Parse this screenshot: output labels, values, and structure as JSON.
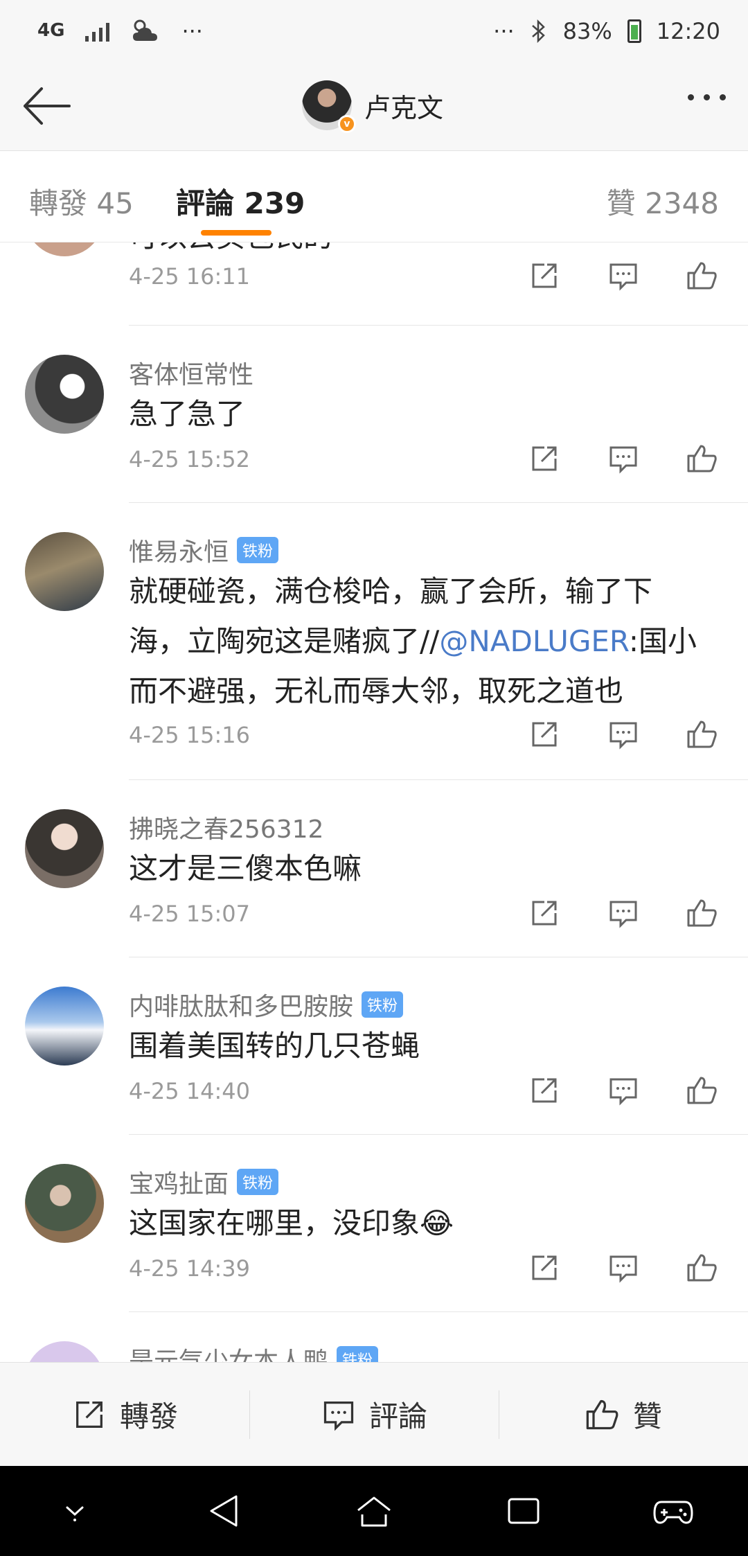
{
  "status_bar": {
    "network": "4G",
    "more_dots": "···",
    "right_dots": "···",
    "battery": "83%",
    "time": "12:20"
  },
  "nav": {
    "title": "卢克文"
  },
  "tabs": [
    {
      "label": "轉發 45"
    },
    {
      "label": "評論 239"
    },
    {
      "label": "贊 2348"
    }
  ],
  "comments": [
    {
      "name": "",
      "text": "可以去买包氏的",
      "time": "4-25 16:11"
    },
    {
      "name": "客体恒常性",
      "text": "急了急了",
      "time": "4-25 15:52"
    },
    {
      "name": "惟易永恒",
      "badge": "铁粉",
      "text_before": "就硬碰瓷，满仓梭哈，赢了会所，输了下海，立陶宛这是赌疯了//",
      "mention": "@NADLUGER",
      "text_after": ":国小而不避强，无礼而辱大邻，取死之道也",
      "time": "4-25 15:16"
    },
    {
      "name": "拂晓之春256312",
      "text": "这才是三傻本色嘛",
      "time": "4-25 15:07"
    },
    {
      "name": "内啡肽肽和多巴胺胺",
      "badge": "铁粉",
      "text": "围着美国转的几只苍蝇",
      "time": "4-25 14:40"
    },
    {
      "name": "宝鸡扯面",
      "badge": "铁粉",
      "text": "这国家在哪里，没印象😂",
      "time": "4-25 14:39"
    },
    {
      "name": "是元气少女本人鸭",
      "badge": "铁粉"
    }
  ],
  "bottom_bar": {
    "repost": "轉發",
    "comment": "評論",
    "like": "贊"
  },
  "colors": {
    "accent": "#ff8200",
    "badge": "#5ea6f5",
    "mention": "#4a7bc8"
  }
}
